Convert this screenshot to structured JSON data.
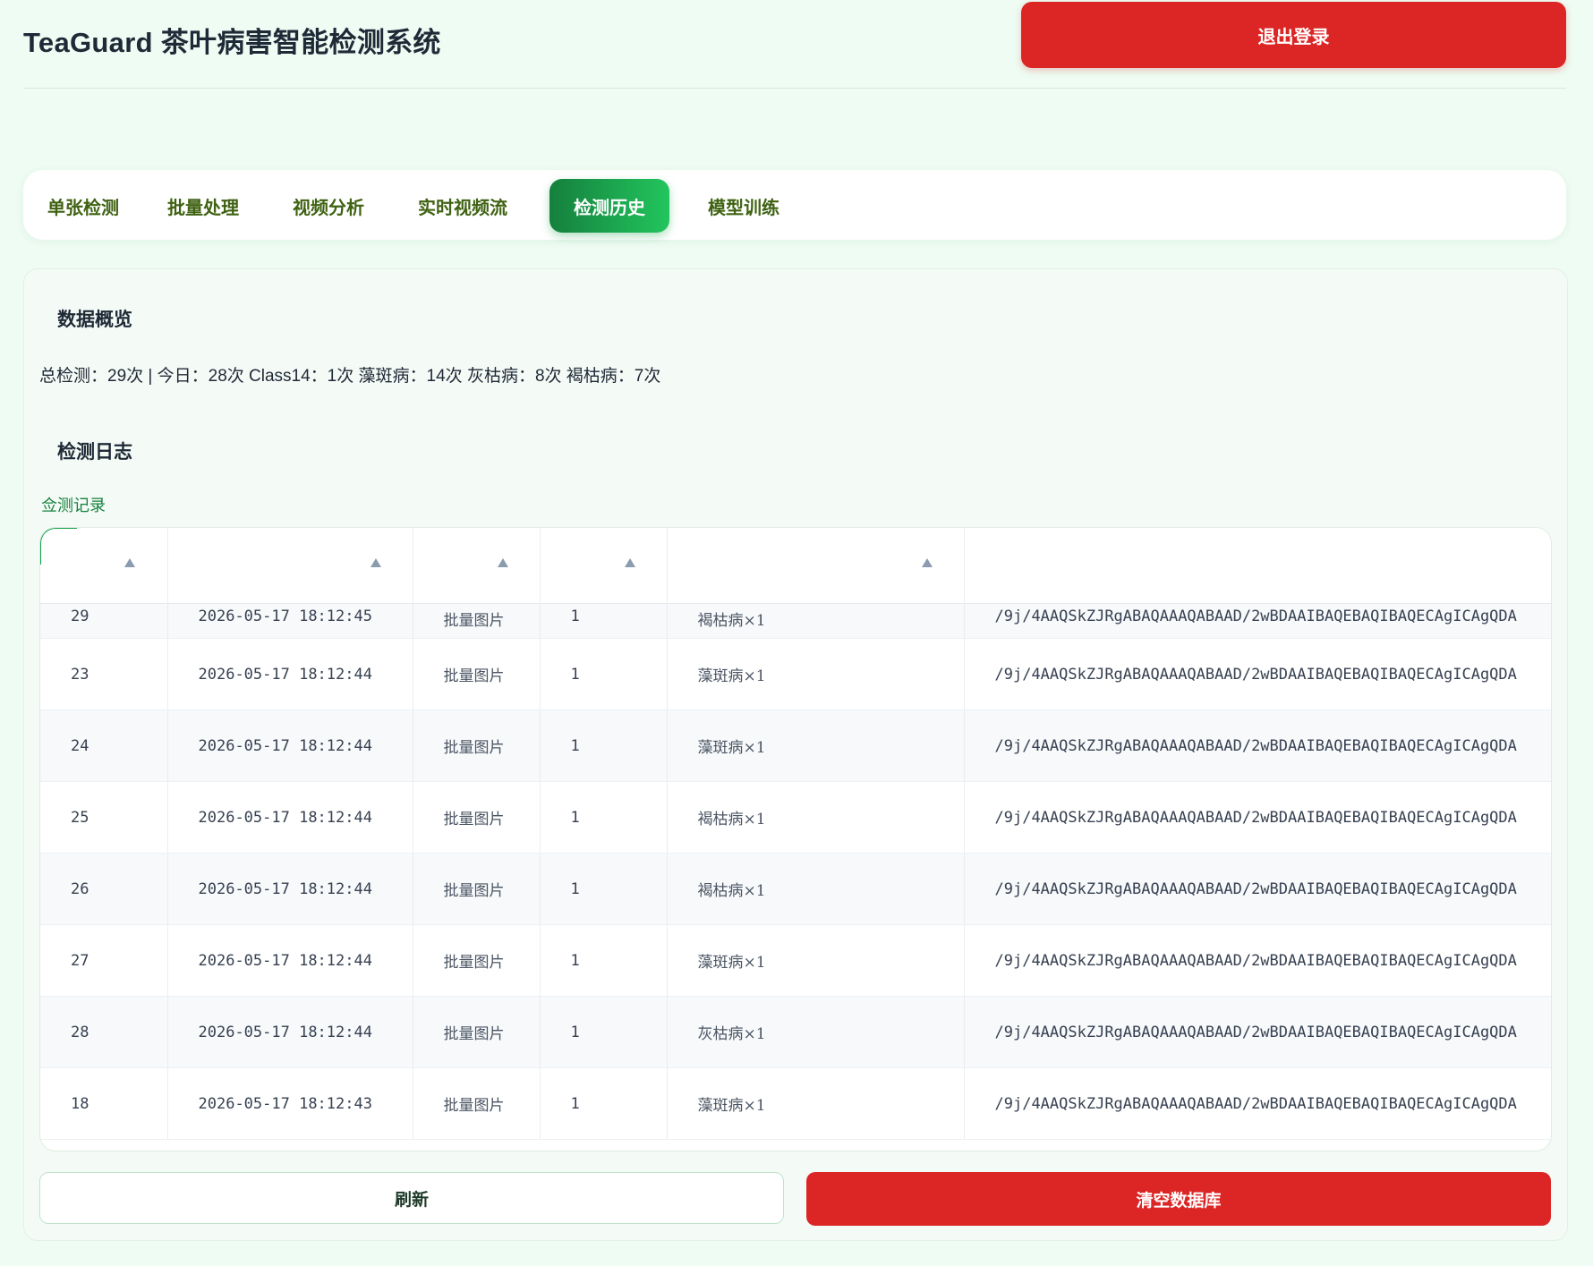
{
  "header": {
    "title": "TeaGuard 茶叶病害智能检测系统",
    "logout_label": "退出登录"
  },
  "tabs": [
    {
      "label": "单张检测",
      "active": false
    },
    {
      "label": "批量处理",
      "active": false
    },
    {
      "label": "视频分析",
      "active": false
    },
    {
      "label": "实时视频流",
      "active": false
    },
    {
      "label": "检测历史",
      "active": true
    },
    {
      "label": "模型训练",
      "active": false
    }
  ],
  "overview": {
    "heading": "数据概览",
    "summary": "总检测：29次 | 今日：28次 Class14：1次 藻斑病：14次 灰枯病：8次 褐枯病：7次"
  },
  "log": {
    "heading": "检测日志",
    "table_label": "佥测记录",
    "rows": [
      {
        "id": "29",
        "time": "2026-05-17 18:12:45",
        "source": "批量图片",
        "count": "1",
        "result": "褐枯病×1",
        "image": "/9j/4AAQSkZJRgABAQAAAQABAAD/2wBDAAIBAQEBAQIBAQECAgICAgQDA"
      },
      {
        "id": "23",
        "time": "2026-05-17 18:12:44",
        "source": "批量图片",
        "count": "1",
        "result": "藻斑病×1",
        "image": "/9j/4AAQSkZJRgABAQAAAQABAAD/2wBDAAIBAQEBAQIBAQECAgICAgQDA"
      },
      {
        "id": "24",
        "time": "2026-05-17 18:12:44",
        "source": "批量图片",
        "count": "1",
        "result": "藻斑病×1",
        "image": "/9j/4AAQSkZJRgABAQAAAQABAAD/2wBDAAIBAQEBAQIBAQECAgICAgQDA"
      },
      {
        "id": "25",
        "time": "2026-05-17 18:12:44",
        "source": "批量图片",
        "count": "1",
        "result": "褐枯病×1",
        "image": "/9j/4AAQSkZJRgABAQAAAQABAAD/2wBDAAIBAQEBAQIBAQECAgICAgQDA"
      },
      {
        "id": "26",
        "time": "2026-05-17 18:12:44",
        "source": "批量图片",
        "count": "1",
        "result": "褐枯病×1",
        "image": "/9j/4AAQSkZJRgABAQAAAQABAAD/2wBDAAIBAQEBAQIBAQECAgICAgQDA"
      },
      {
        "id": "27",
        "time": "2026-05-17 18:12:44",
        "source": "批量图片",
        "count": "1",
        "result": "藻斑病×1",
        "image": "/9j/4AAQSkZJRgABAQAAAQABAAD/2wBDAAIBAQEBAQIBAQECAgICAgQDA"
      },
      {
        "id": "28",
        "time": "2026-05-17 18:12:44",
        "source": "批量图片",
        "count": "1",
        "result": "灰枯病×1",
        "image": "/9j/4AAQSkZJRgABAQAAAQABAAD/2wBDAAIBAQEBAQIBAQECAgICAgQDA"
      },
      {
        "id": "18",
        "time": "2026-05-17 18:12:43",
        "source": "批量图片",
        "count": "1",
        "result": "藻斑病×1",
        "image": "/9j/4AAQSkZJRgABAQAAAQABAAD/2wBDAAIBAQEBAQIBAQECAgICAgQDA"
      }
    ]
  },
  "actions": {
    "refresh_label": "刷新",
    "clear_label": "清空数据库"
  },
  "colors": {
    "accent": "#16a34a",
    "danger": "#dc2626",
    "background": "#eefcf3"
  },
  "icons": {
    "sort": "sort-ascending-icon"
  }
}
